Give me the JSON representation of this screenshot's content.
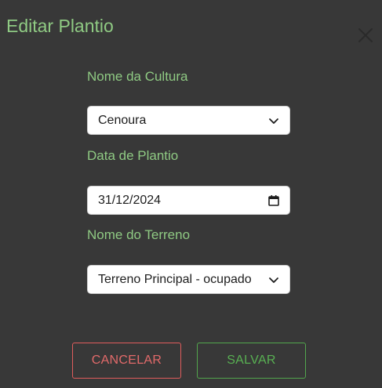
{
  "dialog": {
    "title": "Editar Plantio",
    "close_icon": "close-icon"
  },
  "form": {
    "crop": {
      "label": "Nome da Cultura",
      "value": "Cenoura",
      "icon": "chevron-down-icon"
    },
    "date": {
      "label": "Data de Plantio",
      "value": "31/12/2024",
      "icon": "calendar-icon"
    },
    "terrain": {
      "label": "Nome do Terreno",
      "value": "Terreno Principal - ocupado",
      "icon": "chevron-down-icon"
    }
  },
  "actions": {
    "cancel_label": "CANCELAR",
    "save_label": "SALVAR"
  },
  "colors": {
    "background": "#383838",
    "accent_green": "#8fca83",
    "cancel_red": "#e05c5c",
    "save_green": "#52a64d"
  }
}
